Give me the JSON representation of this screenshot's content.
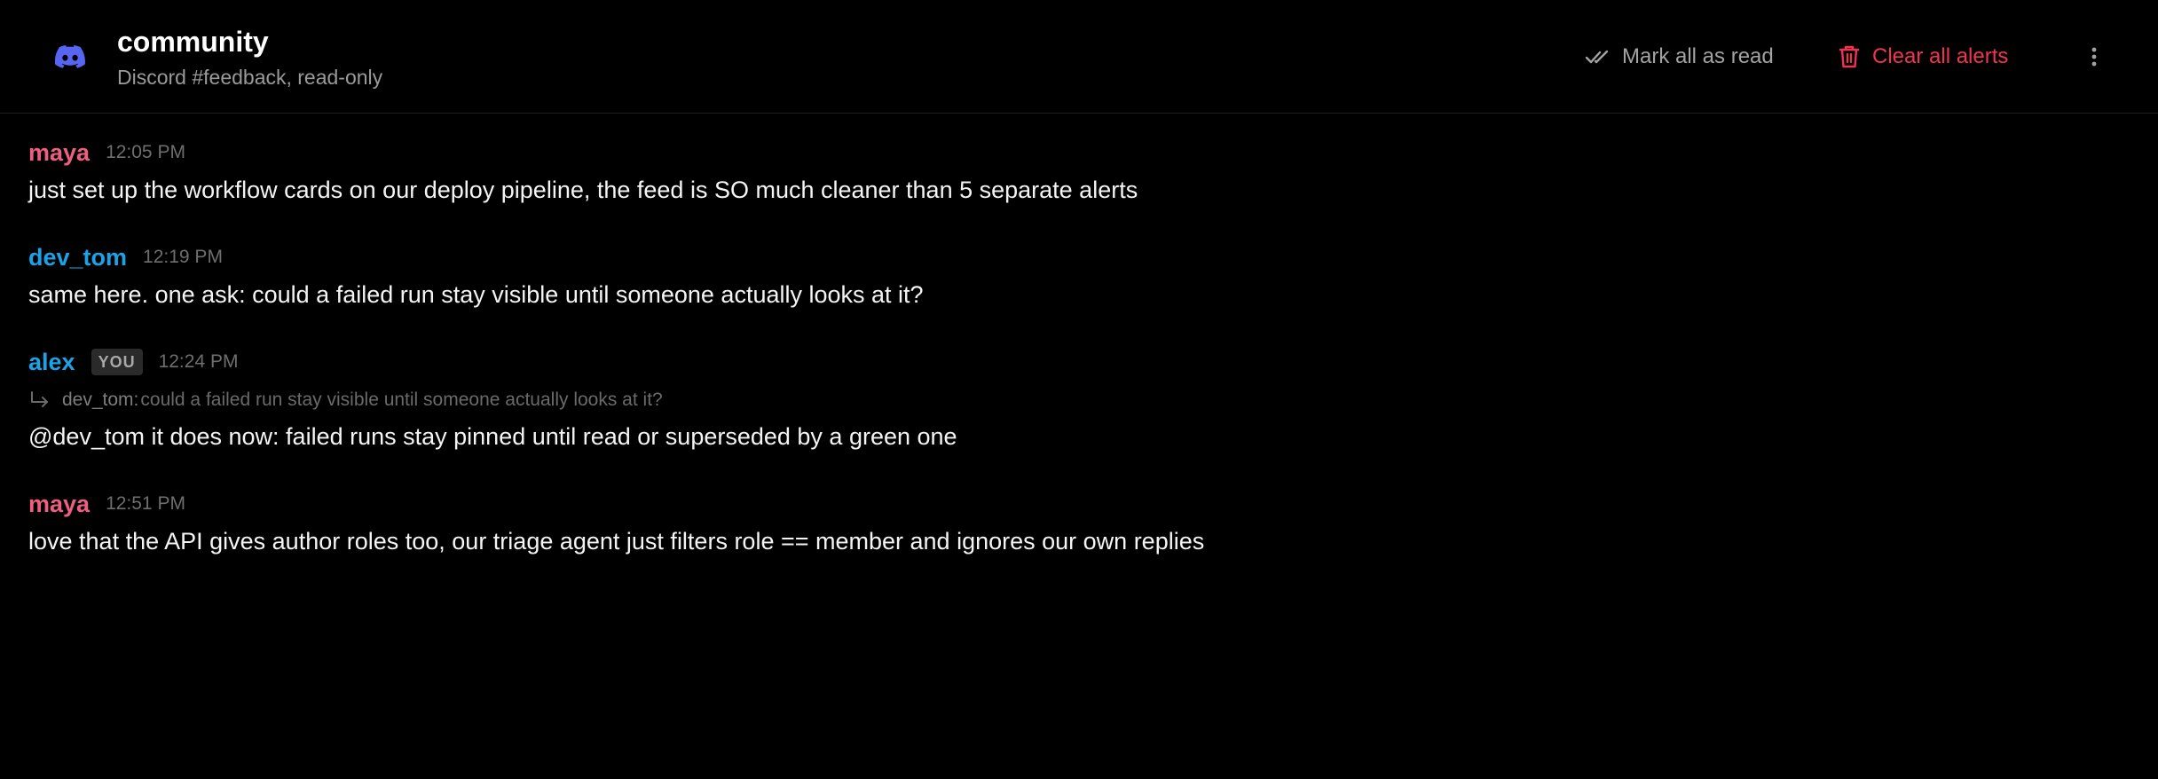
{
  "header": {
    "icon": "discord-icon",
    "title": "community",
    "subtitle": "Discord #feedback, read-only",
    "accent_color": "#5865f2"
  },
  "actions": {
    "mark_read": {
      "label": "Mark all as read",
      "icon": "double-check-icon",
      "color": "#a3a3a3"
    },
    "clear": {
      "label": "Clear all alerts",
      "icon": "trash-icon",
      "color": "#f0344f"
    },
    "more": {
      "icon": "more-vertical-icon"
    }
  },
  "messages": [
    {
      "author": "maya",
      "author_color": "#ee5f7f",
      "time": "12:05 PM",
      "text": "just set up the workflow cards on our deploy pipeline, the feed is SO much cleaner than 5 separate alerts"
    },
    {
      "author": "dev_tom",
      "author_color": "#1aa3e8",
      "time": "12:19 PM",
      "text": "same here. one ask: could a failed run stay visible until someone actually looks at it?"
    },
    {
      "author": "alex",
      "author_color": "#1aa3e8",
      "badge": "YOU",
      "time": "12:24 PM",
      "reply_to": {
        "author": "dev_tom:",
        "text": "could a failed run stay visible until someone actually looks at it?"
      },
      "text": "@dev_tom it does now: failed runs stay pinned until read or superseded by a green one"
    },
    {
      "author": "maya",
      "author_color": "#ee5f7f",
      "time": "12:51 PM",
      "text": "love that the API gives author roles too, our triage agent just filters role == member and ignores our own replies"
    }
  ]
}
